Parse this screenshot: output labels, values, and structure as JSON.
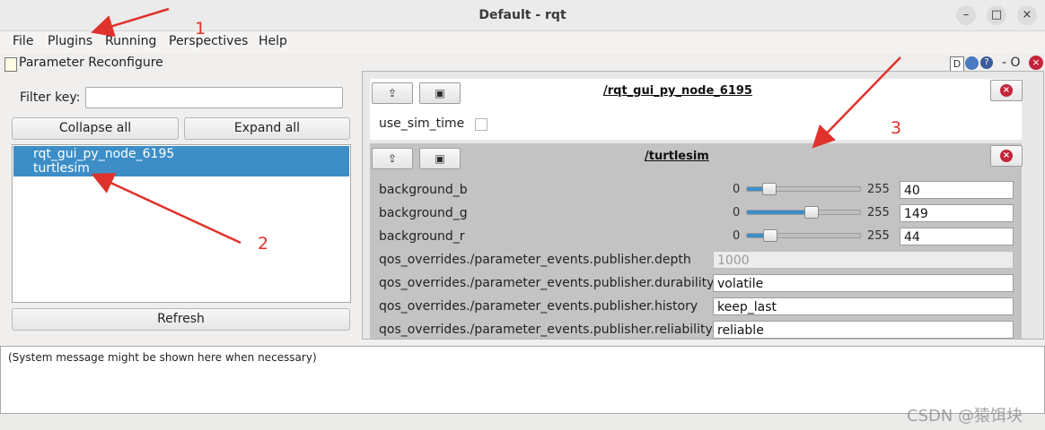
{
  "window": {
    "title": "Default - rqt",
    "minimize_glyph": "–",
    "maximize_glyph": "□",
    "close_glyph": "×"
  },
  "menu": {
    "file": "File",
    "plugins": "Plugins",
    "running": "Running",
    "perspectives": "Perspectives",
    "help": "Help"
  },
  "plugin": {
    "title": "Parameter Reconfigure",
    "title_icon": "edit-icon",
    "right_controls": "D",
    "right_extra": "- O"
  },
  "left": {
    "filter_label": "Filter key:",
    "filter_value": "",
    "collapse_all": "Collapse all",
    "expand_all": "Expand all",
    "nodes": [
      "rqt_gui_py_node_6195",
      "turtlesim"
    ],
    "refresh": "Refresh"
  },
  "node1": {
    "title": "/rqt_gui_py_node_6195",
    "params": [
      {
        "name": "use_sim_time",
        "type": "checkbox",
        "checked": false
      }
    ]
  },
  "node2": {
    "title": "/turtlesim",
    "params": [
      {
        "name": "background_b",
        "min": "0",
        "max": "255",
        "value": "40",
        "fraction": 0.157
      },
      {
        "name": "background_g",
        "min": "0",
        "max": "255",
        "value": "149",
        "fraction": 0.584
      },
      {
        "name": "background_r",
        "min": "0",
        "max": "255",
        "value": "44",
        "fraction": 0.173
      },
      {
        "name": "qos_overrides./parameter_events.publisher.depth",
        "value": "1000",
        "disabled": true
      },
      {
        "name": "qos_overrides./parameter_events.publisher.durability",
        "value": "volatile"
      },
      {
        "name": "qos_overrides./parameter_events.publisher.history",
        "value": "keep_last"
      },
      {
        "name": "qos_overrides./parameter_events.publisher.reliability",
        "value": "reliable"
      }
    ]
  },
  "messages": {
    "text": "(System message might be shown here when necessary)"
  },
  "annotations": [
    "1",
    "2",
    "3"
  ],
  "watermark": "CSDN @猿饵块",
  "colors": {
    "selection": "#3d8ec7",
    "annotation": "#e0322c",
    "close_dot": "#c4253a"
  }
}
